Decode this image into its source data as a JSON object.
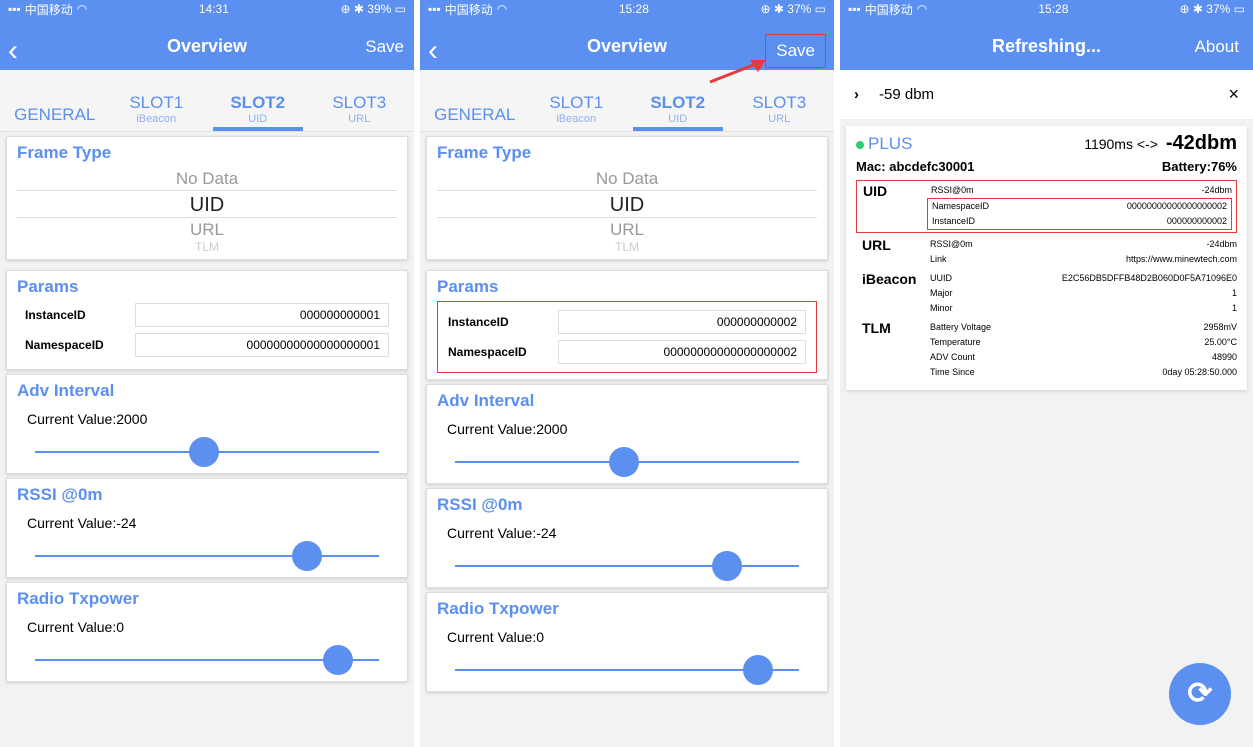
{
  "panel1": {
    "status": {
      "carrier": "中国移动",
      "time": "14:31",
      "battery": "39%"
    },
    "nav": {
      "back": "‹",
      "title": "Overview",
      "right": "Save"
    },
    "tabs": [
      {
        "label": "GENERAL",
        "sub": ""
      },
      {
        "label": "SLOT1",
        "sub": "iBeacon"
      },
      {
        "label": "SLOT2",
        "sub": "UID"
      },
      {
        "label": "SLOT3",
        "sub": "URL"
      }
    ],
    "frame_type": {
      "title": "Frame Type",
      "options": [
        "No Data",
        "UID",
        "URL",
        "TLM"
      ],
      "selected": "UID"
    },
    "params": {
      "title": "Params",
      "instance_label": "InstanceID",
      "instance_value": "000000000001",
      "namespace_label": "NamespaceID",
      "namespace_value": "00000000000000000001"
    },
    "adv": {
      "title": "Adv Interval",
      "current": "Current Value:2000",
      "level": 0.49
    },
    "rssi": {
      "title": "RSSI @0m",
      "current": "Current Value:-24",
      "level": 0.79
    },
    "txpower": {
      "title": "Radio Txpower",
      "current": "Current Value:0",
      "level": 0.88
    }
  },
  "panel2": {
    "status": {
      "carrier": "中国移动",
      "time": "15:28",
      "battery": "37%"
    },
    "nav": {
      "back": "‹",
      "title": "Overview",
      "right": "Save"
    },
    "tabs": [
      {
        "label": "GENERAL",
        "sub": ""
      },
      {
        "label": "SLOT1",
        "sub": "iBeacon"
      },
      {
        "label": "SLOT2",
        "sub": "UID"
      },
      {
        "label": "SLOT3",
        "sub": "URL"
      }
    ],
    "frame_type": {
      "title": "Frame Type",
      "options": [
        "No Data",
        "UID",
        "URL",
        "TLM"
      ],
      "selected": "UID"
    },
    "params": {
      "title": "Params",
      "instance_label": "InstanceID",
      "instance_value": "000000000002",
      "namespace_label": "NamespaceID",
      "namespace_value": "00000000000000000002"
    },
    "adv": {
      "title": "Adv Interval",
      "current": "Current Value:2000",
      "level": 0.49
    },
    "rssi": {
      "title": "RSSI @0m",
      "current": "Current Value:-24",
      "level": 0.79
    },
    "txpower": {
      "title": "Radio Txpower",
      "current": "Current Value:0",
      "level": 0.88
    }
  },
  "panel3": {
    "status": {
      "carrier": "中国移动",
      "time": "15:28",
      "battery": "37%"
    },
    "nav": {
      "title": "Refreshing...",
      "right": "About"
    },
    "filter": {
      "chevron": "›",
      "value": "-59 dbm",
      "close": "×"
    },
    "device": {
      "name": "PLUS",
      "interval": "1190ms <->",
      "rssi": "-42dbm",
      "mac": "Mac: abcdefc30001",
      "battery": "Battery:76%",
      "uid": {
        "name": "UID",
        "rssi_label": "RSSI@0m",
        "rssi_value": "-24dbm",
        "ns_label": "NamespaceID",
        "ns_value": "00000000000000000002",
        "inst_label": "InstanceID",
        "inst_value": "000000000002"
      },
      "url": {
        "name": "URL",
        "rssi_label": "RSSI@0m",
        "rssi_value": "-24dbm",
        "link_label": "Link",
        "link_value": "https://www.minewtech.com"
      },
      "ibeacon": {
        "name": "iBeacon",
        "uuid_label": "UUID",
        "uuid_value": "E2C56DB5DFFB48D2B060D0F5A71096E0",
        "major_label": "Major",
        "major_value": "1",
        "minor_label": "Minor",
        "minor_value": "1"
      },
      "tlm": {
        "name": "TLM",
        "volt_label": "Battery Voltage",
        "volt_value": "2958mV",
        "temp_label": "Temperature",
        "temp_value": "25.00°C",
        "adv_label": "ADV Count",
        "adv_value": "48990",
        "time_label": "Time Since",
        "time_value": "0day 05:28:50.000"
      }
    },
    "fab_icon": "refresh-icon"
  }
}
